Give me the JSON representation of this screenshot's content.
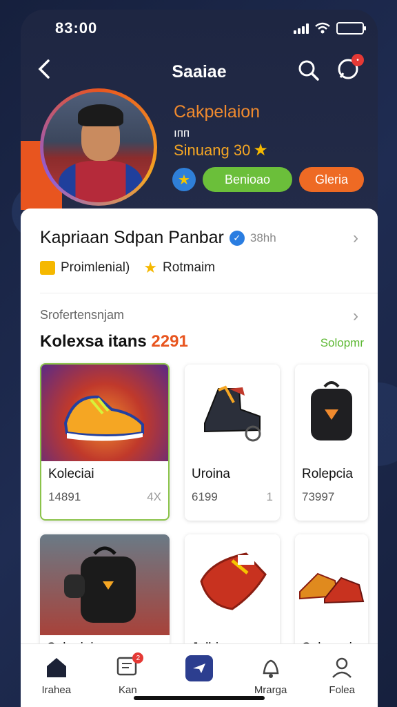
{
  "status": {
    "time": "83:00"
  },
  "header": {
    "title": "Saaiae",
    "chat_badge": "•"
  },
  "profile": {
    "line1": "Cakpelaion",
    "line2": "ıпп",
    "line3": "Sinuang 30",
    "follow_label": "Benioao",
    "second_label": "Gleria"
  },
  "details": {
    "name": "Kapriaan Sdpan Panbar",
    "handle": "38hh",
    "meta": [
      {
        "label": "Proimlenial)"
      },
      {
        "label": "Rotmaim"
      }
    ]
  },
  "collection": {
    "subtitle": "Srofertensnjam",
    "title": "Kolexsa itans",
    "count": "2291",
    "see_all": "Solopmr",
    "items": [
      {
        "label": "Koleciai",
        "value": "14891",
        "extra": "4X"
      },
      {
        "label": "Uroina",
        "value": "6199",
        "extra": "1"
      },
      {
        "label": "Rolepcia",
        "value": "73997",
        "extra": ""
      },
      {
        "label": "Solepiaia",
        "value": "",
        "extra": ""
      },
      {
        "label": "Jalbiam",
        "value": "",
        "extra": ""
      },
      {
        "label": "Solepeci",
        "value": "",
        "extra": ""
      }
    ]
  },
  "nav": {
    "items": [
      {
        "label": "Irahea",
        "icon": "home-icon"
      },
      {
        "label": "Kan",
        "icon": "chat-icon",
        "badge": "2"
      },
      {
        "label": "",
        "icon": "send-icon"
      },
      {
        "label": "Mrarga",
        "icon": "bell-icon"
      },
      {
        "label": "Folea",
        "icon": "user-icon"
      }
    ]
  },
  "colors": {
    "accent_orange": "#e8551f",
    "accent_green": "#6bbf3a",
    "header_bg": "#1e2642"
  }
}
